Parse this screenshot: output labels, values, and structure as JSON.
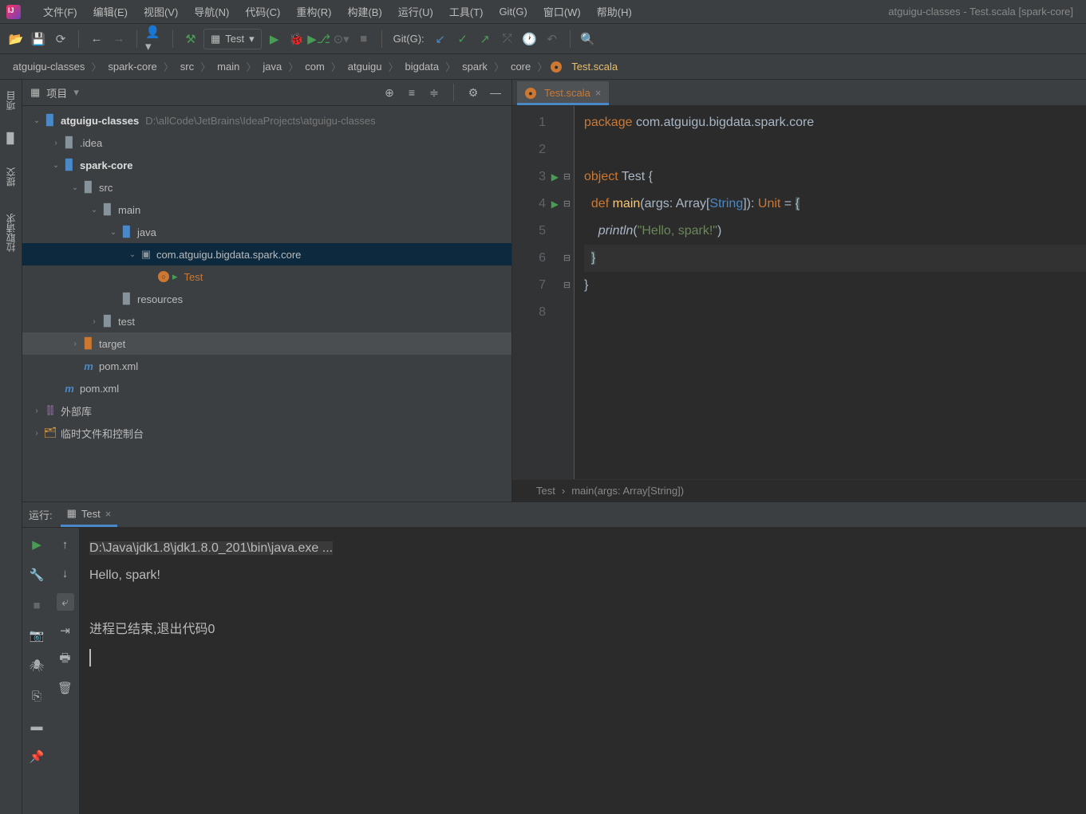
{
  "window_title": "atguigu-classes - Test.scala [spark-core]",
  "menu": [
    "文件(F)",
    "编辑(E)",
    "视图(V)",
    "导航(N)",
    "代码(C)",
    "重构(R)",
    "构建(B)",
    "运行(U)",
    "工具(T)",
    "Git(G)",
    "窗口(W)",
    "帮助(H)"
  ],
  "toolbar": {
    "run_config": "Test",
    "git_label": "Git(G):"
  },
  "breadcrumb": [
    "atguigu-classes",
    "spark-core",
    "src",
    "main",
    "java",
    "com",
    "atguigu",
    "bigdata",
    "spark",
    "core",
    "Test.scala"
  ],
  "gutter": {
    "project": "项目",
    "commit": "提交",
    "pull": "拉取请求"
  },
  "panel": {
    "title": "项目"
  },
  "tree": {
    "root": "atguigu-classes",
    "root_path": "D:\\allCode\\JetBrains\\IdeaProjects\\atguigu-classes",
    "idea": ".idea",
    "sparkcore": "spark-core",
    "src": "src",
    "main": "main",
    "java": "java",
    "pkg": "com.atguigu.bigdata.spark.core",
    "test_file": "Test",
    "resources": "resources",
    "test_dir": "test",
    "target": "target",
    "pom1": "pom.xml",
    "pom2": "pom.xml",
    "ext_lib": "外部库",
    "scratch": "临时文件和控制台"
  },
  "editor": {
    "tab": "Test.scala",
    "lines": [
      "1",
      "2",
      "3",
      "4",
      "5",
      "6",
      "7",
      "8"
    ],
    "code": {
      "pkg_kw": "package",
      "pkg_val": "com.atguigu.bigdata.spark.core",
      "obj_kw": "object",
      "obj_name": "Test",
      "brace_o": "{",
      "def_kw": "def",
      "main": "main",
      "args": "(args: Array[",
      "string": "String",
      "args2": "]): ",
      "unit": "Unit",
      "eq": " = ",
      "brace_o2": "{",
      "println": "println",
      "str": "\"Hello, spark!\"",
      "paren": "(",
      "brace_c1": "}",
      "brace_c2": "}",
      "brace_c_paren": ")"
    },
    "crumb1": "Test",
    "crumb2": "main(args: Array[String])"
  },
  "run": {
    "label": "运行:",
    "tab": "Test",
    "cmd": "D:\\Java\\jdk1.8\\jdk1.8.0_201\\bin\\java.exe ...",
    "out": "Hello, spark!",
    "exit": "进程已结束,退出代码0"
  }
}
